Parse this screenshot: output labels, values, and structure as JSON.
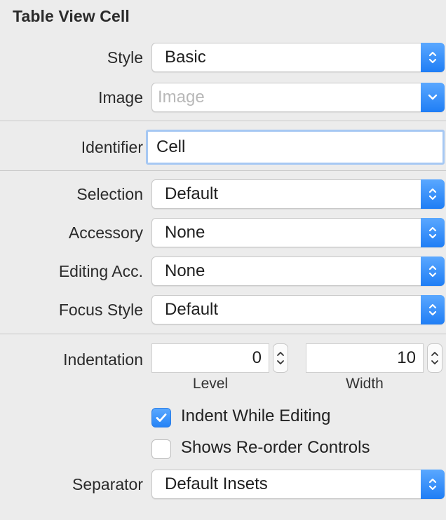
{
  "section": {
    "title": "Table View Cell"
  },
  "style": {
    "label": "Style",
    "value": "Basic"
  },
  "image": {
    "label": "Image",
    "placeholder": "Image"
  },
  "identifier": {
    "label": "Identifier",
    "value": "Cell"
  },
  "selection": {
    "label": "Selection",
    "value": "Default"
  },
  "accessory": {
    "label": "Accessory",
    "value": "None"
  },
  "editing_accessory": {
    "label": "Editing Acc.",
    "value": "None"
  },
  "focus_style": {
    "label": "Focus Style",
    "value": "Default"
  },
  "indentation": {
    "label": "Indentation",
    "level": {
      "value": "0",
      "caption": "Level"
    },
    "width": {
      "value": "10",
      "caption": "Width"
    }
  },
  "checkboxes": {
    "indent_while_editing": {
      "label": "Indent While Editing",
      "checked": true
    },
    "shows_reorder": {
      "label": "Shows Re-order Controls",
      "checked": false
    }
  },
  "separator": {
    "label": "Separator",
    "value": "Default Insets"
  },
  "colors": {
    "accent": "#1f7ef5",
    "focus_ring": "#a6c8f3",
    "background": "#ececec"
  },
  "icons": {
    "popup": "up-down-chevron-icon",
    "dropdown": "chevron-down-icon",
    "stepper": "stepper-icon",
    "check": "checkmark-icon"
  }
}
